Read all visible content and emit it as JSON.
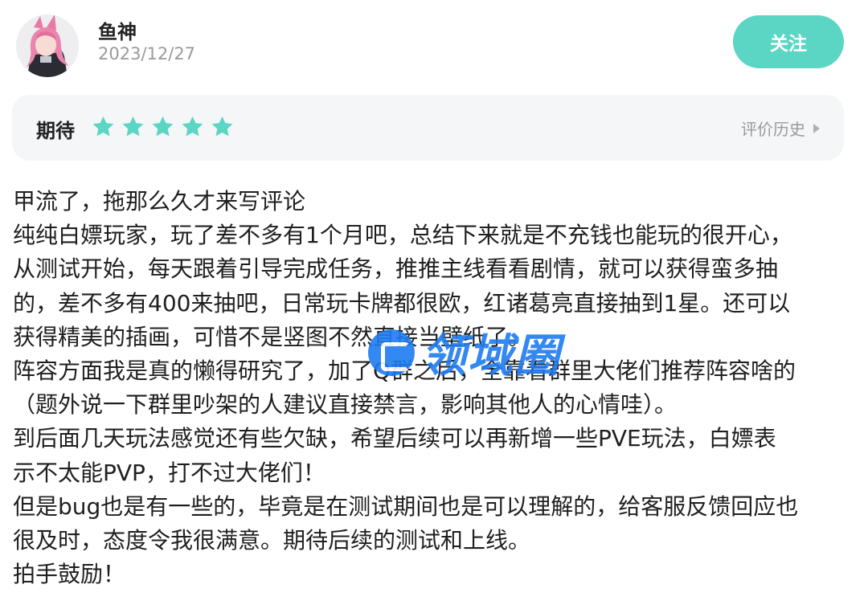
{
  "user": {
    "name": "鱼神",
    "date": "2023/12/27",
    "follow_label": "关注",
    "avatar_icon": "anime-avatar-icon"
  },
  "rating": {
    "label": "期待",
    "stars": 5,
    "max_stars": 5,
    "star_color": "#5cd6c4",
    "history_label": "评价历史",
    "history_icon": "play-arrow-icon"
  },
  "review": {
    "lines": [
      "甲流了，拖那么久才来写评论",
      "纯纯白嫖玩家，玩了差不多有1个月吧，总结下来就是不充钱也能玩的很开心，",
      "从测试开始，每天跟着引导完成任务，推推主线看看剧情，就可以获得蛮多抽",
      "的，差不多有400来抽吧，日常玩卡牌都很欧，红诸葛亮直接抽到1星。还可以",
      "获得精美的插画，可惜不是竖图不然直接当壁纸了。",
      "阵容方面我是真的懒得研究了，加了Q群之后，全靠看群里大佬们推荐阵容啥的",
      "（题外说一下群里吵架的人建议直接禁言，影响其他人的心情哇）。",
      "到后面几天玩法感觉还有些欠缺，希望后续可以再新增一些PVE玩法，白嫖表",
      "示不太能PVP，打不过大佬们！",
      "但是bug也是有一些的，毕竟是在测试期间也是可以理解的，给客服反馈回应也",
      "很及时，态度令我很满意。期待后续的测试和上线。",
      "拍手鼓励！"
    ]
  },
  "watermark": {
    "text": "领域圈",
    "color": "#1f7cf0"
  }
}
